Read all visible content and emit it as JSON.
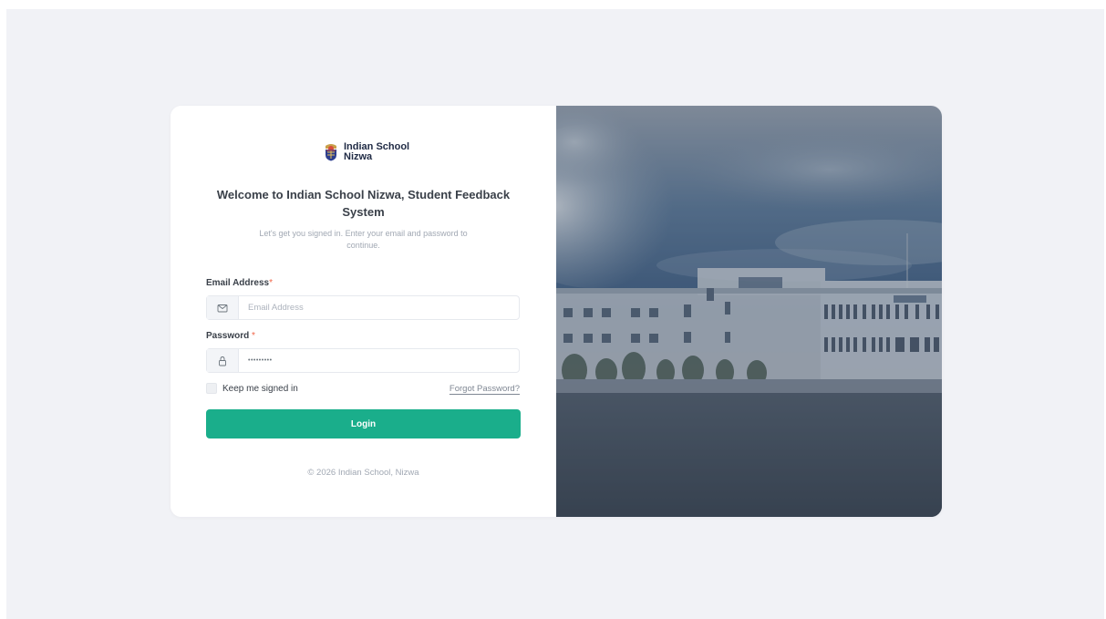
{
  "brand": {
    "name_line1": "Indian School",
    "name_line2": "Nizwa"
  },
  "form": {
    "title": "Welcome to Indian School Nizwa, Student Feedback System",
    "subtitle": "Let's get you signed in. Enter your email and password to continue.",
    "email_label": "Email Address",
    "email_required": "*",
    "email_placeholder": "Email Address",
    "email_icon": "envelope-icon",
    "password_label": "Password",
    "password_required": "*",
    "password_value": "•••••••••",
    "password_icon": "lock-icon",
    "remember_label": "Keep me signed in",
    "remember_checked": false,
    "forgot_label": "Forgot Password?",
    "login_label": "Login"
  },
  "footer": {
    "copyright": "© 2026 Indian School, Nizwa"
  },
  "colors": {
    "accent": "#1aae8b",
    "required": "#f06548",
    "background": "#f1f2f6"
  }
}
